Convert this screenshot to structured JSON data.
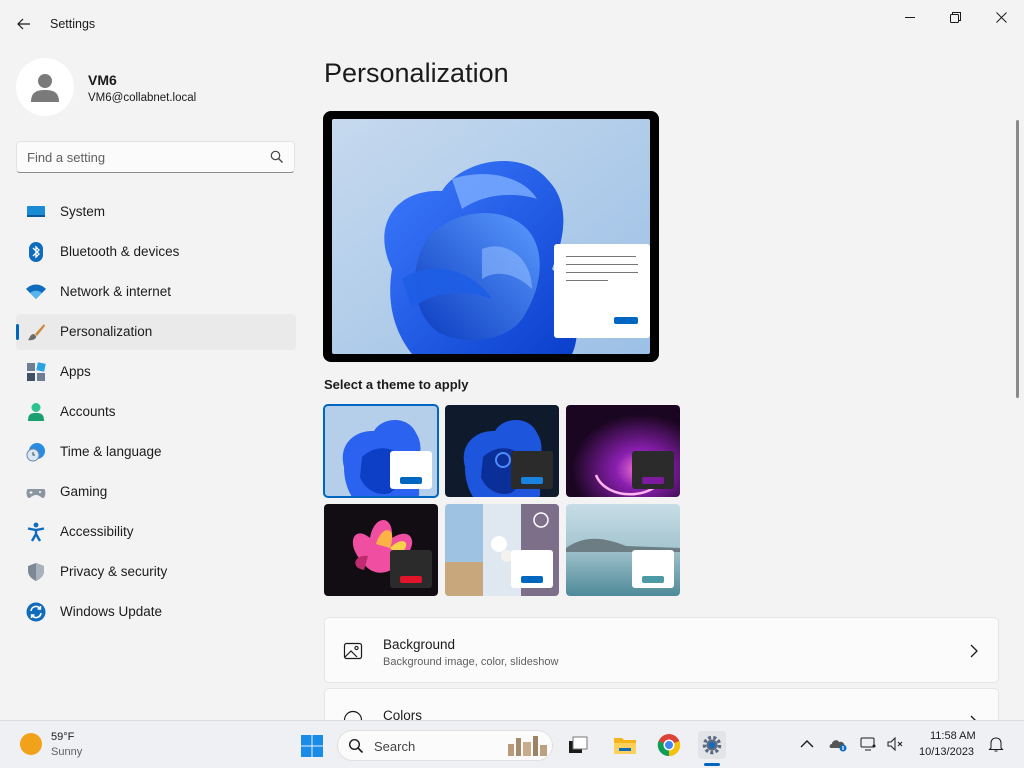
{
  "window": {
    "title": "Settings"
  },
  "profile": {
    "name": "VM6",
    "email": "VM6@collabnet.local"
  },
  "search": {
    "placeholder": "Find a setting"
  },
  "sidebar": {
    "items": [
      {
        "label": "System",
        "icon": "monitor-icon"
      },
      {
        "label": "Bluetooth & devices",
        "icon": "bluetooth-icon"
      },
      {
        "label": "Network & internet",
        "icon": "wifi-icon"
      },
      {
        "label": "Personalization",
        "icon": "paintbrush-icon",
        "active": true
      },
      {
        "label": "Apps",
        "icon": "apps-icon"
      },
      {
        "label": "Accounts",
        "icon": "person-icon"
      },
      {
        "label": "Time & language",
        "icon": "globe-clock-icon"
      },
      {
        "label": "Gaming",
        "icon": "gamepad-icon"
      },
      {
        "label": "Accessibility",
        "icon": "accessibility-icon"
      },
      {
        "label": "Privacy & security",
        "icon": "shield-icon"
      },
      {
        "label": "Windows Update",
        "icon": "update-icon"
      }
    ]
  },
  "main": {
    "title": "Personalization",
    "select_theme_label": "Select a theme to apply",
    "themes": [
      {
        "name": "windows-light",
        "selected": true
      },
      {
        "name": "windows-dark"
      },
      {
        "name": "glow"
      },
      {
        "name": "captured-motion"
      },
      {
        "name": "flow"
      },
      {
        "name": "sunrise"
      }
    ],
    "cards": [
      {
        "title": "Background",
        "subtitle": "Background image, color, slideshow",
        "icon": "image-icon"
      },
      {
        "title": "Colors",
        "subtitle": "",
        "icon": "palette-icon"
      }
    ]
  },
  "taskbar": {
    "weather": {
      "temp": "59°F",
      "condition": "Sunny"
    },
    "search_label": "Search",
    "time": "11:58 AM",
    "date": "10/13/2023"
  },
  "colors": {
    "accent": "#0067c0",
    "background": "#f3f3f3"
  }
}
